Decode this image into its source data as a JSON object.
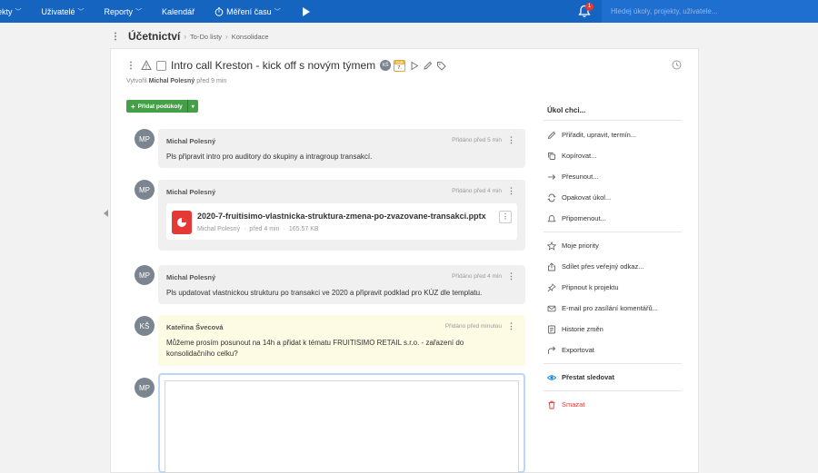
{
  "nav": {
    "items": [
      {
        "label": "ekty",
        "chevron": true
      },
      {
        "label": "Uživatelé",
        "chevron": true
      },
      {
        "label": "Reporty",
        "chevron": true
      },
      {
        "label": "Kalendář",
        "chevron": false
      },
      {
        "label": "Měření času",
        "chevron": true
      }
    ],
    "notification_count": "1",
    "search_placeholder": "Hledej úkoly, projekty, uživatele..."
  },
  "breadcrumb": {
    "root": "Účetnictví",
    "items": [
      "To-Do listy",
      "Konsolidace"
    ]
  },
  "task": {
    "title": "Intro call Kreston - kick off s novým týmem",
    "assignee_initials": "KŠ",
    "due_month": "DUB",
    "due_day": "7.",
    "created_prefix": "Vytvořil",
    "created_by": "Michal Polesný",
    "created_ago": "před 9 min"
  },
  "add_subtasks_label": "Přidat podúkoly",
  "comments": [
    {
      "initials": "MP",
      "author": "Michal Polesný",
      "time": "Přidáno před 5 min",
      "text": "Pls připravit intro pro auditory do skupiny a intragroup transakcí."
    },
    {
      "initials": "MP",
      "author": "Michal Polesný",
      "time": "Přidáno před 4 min",
      "file": {
        "name": "2020-7-fruitisimo-vlastnicka-struktura-zmena-po-zvazovane-transakci.pptx",
        "author": "Michal Polesný",
        "ago": "před 4 min",
        "size": "165.57 KB"
      }
    },
    {
      "initials": "MP",
      "author": "Michal Polesný",
      "time": "Přidáno před 4 min",
      "text": "Pls updatovat vlastnickou strukturu po transakci ve 2020 a připravit podklad pro KÚZ dle templatu."
    },
    {
      "initials": "KŠ",
      "author": "Kateřina Švecová",
      "time": "Přidáno před minutou",
      "text": "Můžeme prosím posunout na 14h a přidat k tématu FRUITISIMO RETAIL s.r.o. - zařazení do konsolidačního celku?"
    }
  ],
  "editor": {
    "initials": "MP"
  },
  "sidebar": {
    "title": "Úkol chci...",
    "groups": [
      [
        {
          "icon": "pencil-icon",
          "label": "Přiřadit, upravit, termín..."
        },
        {
          "icon": "copy-icon",
          "label": "Kopírovat..."
        },
        {
          "icon": "arrow-right-icon",
          "label": "Přesunout..."
        },
        {
          "icon": "repeat-icon",
          "label": "Opakovat úkol..."
        },
        {
          "icon": "reminder-icon",
          "label": "Připomenout..."
        }
      ],
      [
        {
          "icon": "star-icon",
          "label": "Moje priority"
        },
        {
          "icon": "share-icon",
          "label": "Sdílet přes veřejný odkaz..."
        },
        {
          "icon": "pin-icon",
          "label": "Připnout k projektu"
        },
        {
          "icon": "email-icon",
          "label": "E-mail pro zasílání komentářů..."
        },
        {
          "icon": "history-icon",
          "label": "Historie změn"
        },
        {
          "icon": "export-icon",
          "label": "Exportovat"
        }
      ],
      [
        {
          "icon": "eye-icon",
          "label": "Přestat sledovat",
          "style": "bold"
        }
      ],
      [
        {
          "icon": "trash-icon",
          "label": "Smazat",
          "style": "red"
        }
      ]
    ]
  },
  "colors": {
    "topbar": "#1565c0",
    "accent_green": "#43a047",
    "danger": "#e53935",
    "highlight_comment": "#fdfbe3"
  }
}
